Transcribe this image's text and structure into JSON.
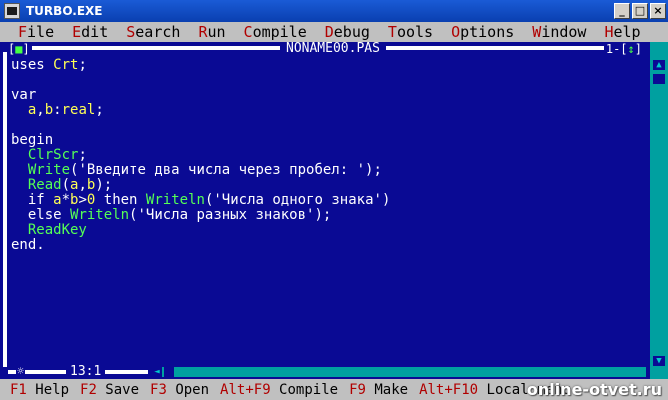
{
  "window": {
    "title": "TURBO.EXE",
    "buttons": [
      "_",
      "□",
      "×"
    ]
  },
  "menu": {
    "system": "≡",
    "items": [
      {
        "hot": "F",
        "rest": "ile"
      },
      {
        "hot": "E",
        "rest": "dit"
      },
      {
        "hot": "S",
        "rest": "earch"
      },
      {
        "hot": "R",
        "rest": "un"
      },
      {
        "hot": "C",
        "rest": "ompile"
      },
      {
        "hot": "D",
        "rest": "ebug"
      },
      {
        "hot": "T",
        "rest": "ools"
      },
      {
        "hot": "O",
        "rest": "ptions"
      },
      {
        "hot": "W",
        "rest": "indow"
      },
      {
        "hot": "H",
        "rest": "elp"
      }
    ]
  },
  "editor": {
    "close_box": "[",
    "close_glyph": "■",
    "close_end": "]",
    "filename": "NONAME00.PAS",
    "window_number": "1",
    "zoom_glyph": "↕",
    "cursor_position": "13:1",
    "modified_marker": "☼",
    "code": [
      [
        {
          "t": "uses ",
          "c": "kw"
        },
        {
          "t": "Crt",
          "c": "id"
        },
        {
          "t": ";",
          "c": "kw"
        }
      ],
      [],
      [
        {
          "t": "var",
          "c": "kw"
        }
      ],
      [
        {
          "t": "  a",
          "c": "id"
        },
        {
          "t": ",",
          "c": "kw"
        },
        {
          "t": "b",
          "c": "id"
        },
        {
          "t": ":",
          "c": "kw"
        },
        {
          "t": "real",
          "c": "id"
        },
        {
          "t": ";",
          "c": "kw"
        }
      ],
      [],
      [
        {
          "t": "begin",
          "c": "kw"
        }
      ],
      [
        {
          "t": "  ClrScr",
          "c": "std"
        },
        {
          "t": ";",
          "c": "kw"
        }
      ],
      [
        {
          "t": "  Write",
          "c": "std"
        },
        {
          "t": "('Введите два числа через пробел: ');",
          "c": "str"
        }
      ],
      [
        {
          "t": "  Read",
          "c": "std"
        },
        {
          "t": "(",
          "c": "kw"
        },
        {
          "t": "a",
          "c": "id"
        },
        {
          "t": ",",
          "c": "kw"
        },
        {
          "t": "b",
          "c": "id"
        },
        {
          "t": ");",
          "c": "kw"
        }
      ],
      [
        {
          "t": "  if ",
          "c": "kw"
        },
        {
          "t": "a",
          "c": "id"
        },
        {
          "t": "*",
          "c": "kw"
        },
        {
          "t": "b",
          "c": "id"
        },
        {
          "t": ">",
          "c": "kw"
        },
        {
          "t": "0",
          "c": "id"
        },
        {
          "t": " then ",
          "c": "kw"
        },
        {
          "t": "Writeln",
          "c": "std"
        },
        {
          "t": "('Числа одного знака')",
          "c": "str"
        }
      ],
      [
        {
          "t": "  else ",
          "c": "kw"
        },
        {
          "t": "Writeln",
          "c": "std"
        },
        {
          "t": "('Числа разных знаков');",
          "c": "str"
        }
      ],
      [
        {
          "t": "  ReadKey",
          "c": "std"
        }
      ],
      [
        {
          "t": "end",
          "c": "kw"
        },
        {
          "t": ".",
          "c": "kw"
        }
      ]
    ]
  },
  "statusbar": {
    "items": [
      {
        "key": "F1",
        "label": " Help"
      },
      {
        "key": "F2",
        "label": " Save"
      },
      {
        "key": "F3",
        "label": " Open"
      },
      {
        "key": "Alt+F9",
        "label": " Compile"
      },
      {
        "key": "F9",
        "label": " Make"
      },
      {
        "key": "Alt+F10",
        "label": " Local menu"
      }
    ],
    "watermark": "online-otvet.ru"
  },
  "colors": {
    "editor_bg": "#0a0a94",
    "identifier": "#ffff55",
    "standard_proc": "#55ff55",
    "hotkey": "#b00000"
  }
}
